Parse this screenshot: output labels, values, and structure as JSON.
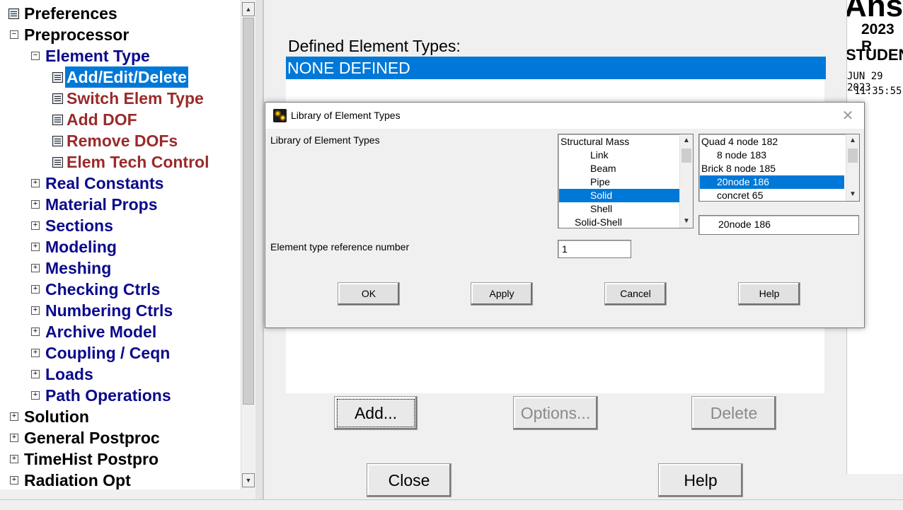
{
  "tree": {
    "items": [
      {
        "label": "Preferences",
        "expander": "",
        "icon": "form"
      },
      {
        "label": "Preprocessor",
        "expander": "⊟"
      },
      {
        "label": "Element Type",
        "expander": "⊟"
      },
      {
        "label": "Add/Edit/Delete",
        "icon": "form",
        "selected": true
      },
      {
        "label": "Switch Elem Type",
        "icon": "form"
      },
      {
        "label": "Add DOF",
        "icon": "form"
      },
      {
        "label": "Remove DOFs",
        "icon": "form"
      },
      {
        "label": "Elem Tech Control",
        "icon": "form"
      },
      {
        "label": "Real Constants",
        "expander": "⊞"
      },
      {
        "label": "Material Props",
        "expander": "⊞"
      },
      {
        "label": "Sections",
        "expander": "⊞"
      },
      {
        "label": "Modeling",
        "expander": "⊞"
      },
      {
        "label": "Meshing",
        "expander": "⊞"
      },
      {
        "label": "Checking Ctrls",
        "expander": "⊞"
      },
      {
        "label": "Numbering Ctrls",
        "expander": "⊞"
      },
      {
        "label": "Archive Model",
        "expander": "⊞"
      },
      {
        "label": "Coupling / Ceqn",
        "expander": "⊞"
      },
      {
        "label": "Loads",
        "expander": "⊞"
      },
      {
        "label": "Path Operations",
        "expander": "⊞"
      },
      {
        "label": "Solution",
        "expander": "⊞"
      },
      {
        "label": "General Postproc",
        "expander": "⊞"
      },
      {
        "label": "TimeHist Postpro",
        "expander": "⊞"
      },
      {
        "label": "Radiation Opt",
        "expander": "⊞"
      }
    ],
    "colors": {
      "top_level": "#000000",
      "sub_level": "#0a0a8c",
      "leaf": "#9a2a2a",
      "selected_bg": "#0078d7"
    }
  },
  "element_types_window": {
    "title": "Defined Element Types:",
    "list_items": [
      "NONE DEFINED"
    ],
    "add_label": "Add...",
    "options_label": "Options...",
    "delete_label": "Delete",
    "close_label": "Close",
    "help_label": "Help"
  },
  "graphics": {
    "logo_text": "Ansys",
    "year_text": "2023 R",
    "edition_text": "STUDENT",
    "date_text": "JUN 29 2023",
    "time_text": "11:35:55"
  },
  "dialog": {
    "title": "Library of Element Types",
    "library_label": "Library of Element Types",
    "categories": [
      "Structural Mass",
      "Link",
      "Beam",
      "Pipe",
      "Solid",
      "Shell",
      "Solid-Shell"
    ],
    "selected_category": "Solid",
    "element_types": [
      "Quad  4 node 182",
      "8 node 183",
      "Brick 8 node 185",
      "20node 186",
      "concret 65"
    ],
    "selected_element_type": "20node 186",
    "selection_text": "20node 186",
    "ref_number_label": "Element type reference number",
    "ref_number_value": "1",
    "ok_label": "OK",
    "apply_label": "Apply",
    "cancel_label": "Cancel",
    "help_label": "Help",
    "accent_color": "#0078d7"
  }
}
